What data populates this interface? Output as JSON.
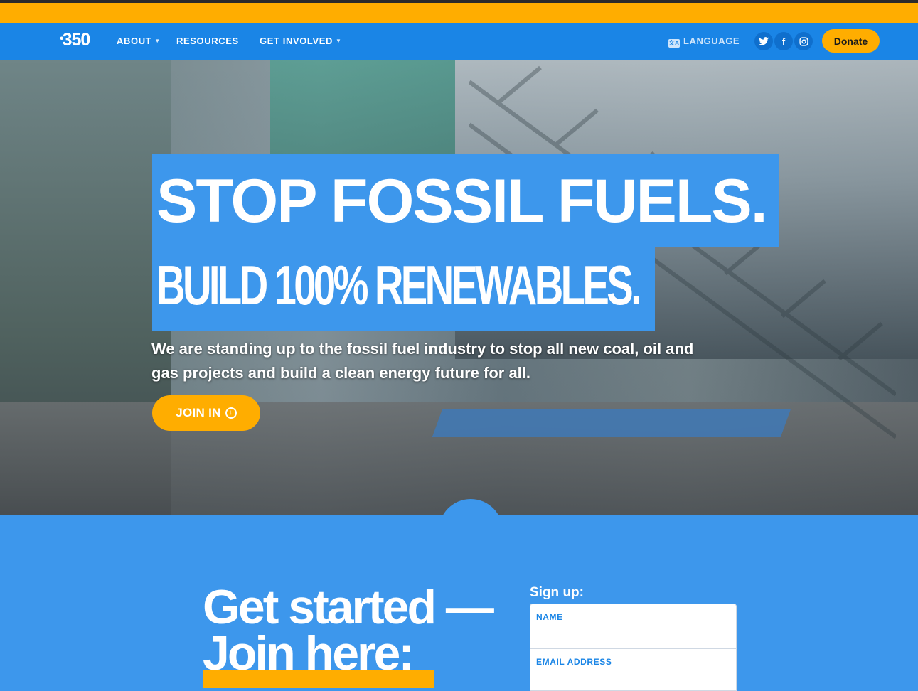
{
  "nav": {
    "logo": "350",
    "logo_dot": "•",
    "about": "ABOUT",
    "resources": "RESOURCES",
    "get_involved": "GET INVOLVED",
    "language": "LANGUAGE",
    "donate": "Donate",
    "social": {
      "twitter": "t",
      "facebook": "f",
      "instagram": "◎"
    }
  },
  "hero": {
    "headline1": "STOP FOSSIL FUELS.",
    "headline2": "BUILD 100% RENEWABLES.",
    "subtitle": "We are standing up to the fossil fuel industry to stop all new coal, oil and gas projects and build a clean energy future for all.",
    "cta": "JOIN IN"
  },
  "signup_section": {
    "heading_line1": "Get started —",
    "heading_line2": "Join here:",
    "form_label": "Sign up:",
    "name_label": "NAME",
    "email_label": "EMAIL ADDRESS"
  },
  "colors": {
    "top_strip": "#ffad00",
    "nav_bg": "#1a85e6",
    "accent_blue": "#3d97ec",
    "accent_yellow": "#ffad00"
  }
}
